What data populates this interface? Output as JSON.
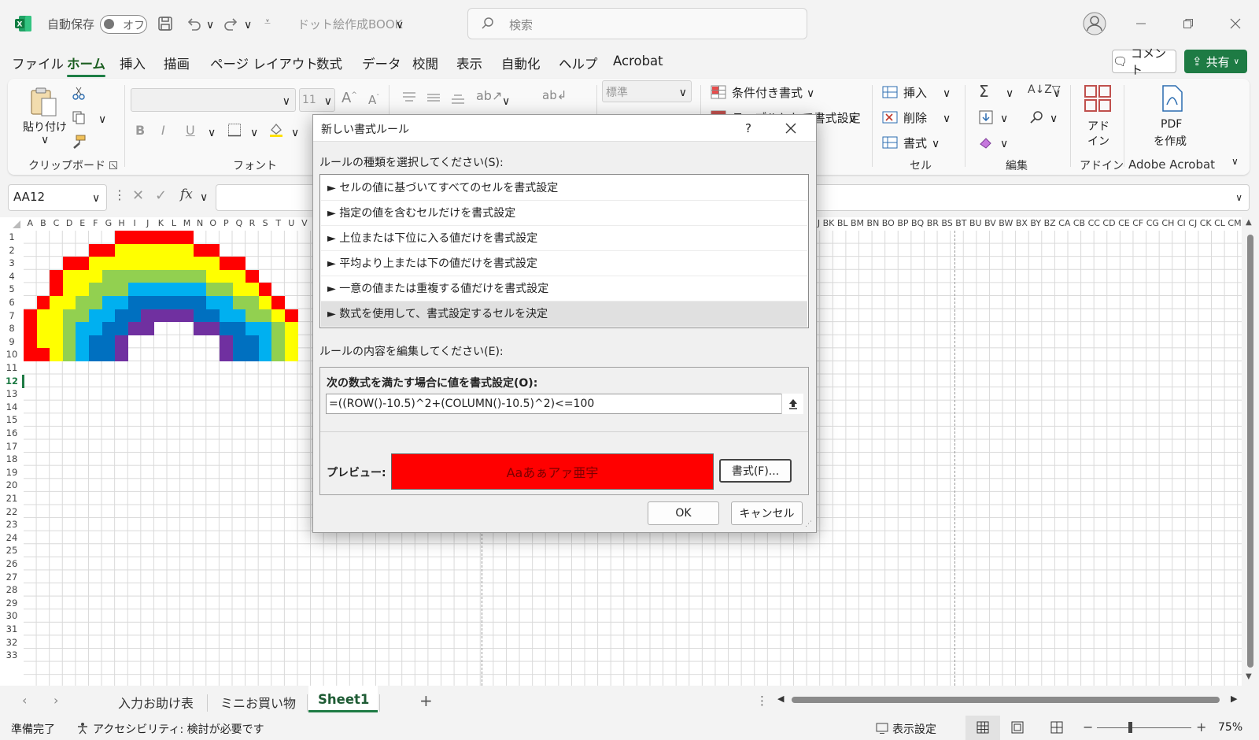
{
  "titlebar": {
    "autosave_label": "自動保存",
    "autosave_state": "オフ",
    "filename": "ドット絵作成BOOK",
    "search_placeholder": "検索"
  },
  "menu_tabs": [
    "ファイル",
    "ホーム",
    "挿入",
    "描画",
    "ページ レイアウト",
    "数式",
    "データ",
    "校閲",
    "表示",
    "自動化",
    "ヘルプ",
    "Acrobat"
  ],
  "menu_active": "ホーム",
  "actions": {
    "comment": "コメント",
    "share": "共有"
  },
  "ribbon": {
    "clipboard": {
      "paste": "貼り付け",
      "group": "クリップボード"
    },
    "font": {
      "font_size": "11",
      "group": "フォント"
    },
    "number": {
      "format": "標準"
    },
    "styles": {
      "conditional": "条件付き書式",
      "table": "テーブルとして書式設定"
    },
    "cells": {
      "insert": "挿入",
      "delete": "削除",
      "format": "書式",
      "group": "セル"
    },
    "editing": {
      "group": "編集"
    },
    "addins": {
      "label1": "アド",
      "label2": "イン",
      "group": "アドイン"
    },
    "acrobat": {
      "label1": "PDF",
      "label2": "を作成",
      "group": "Adobe Acrobat"
    }
  },
  "formula_bar": {
    "name_box": "AA12",
    "fx": "fx"
  },
  "grid": {
    "columns_left": [
      "A",
      "B",
      "C",
      "D",
      "E",
      "F",
      "G",
      "H",
      "I",
      "J",
      "K",
      "L",
      "M",
      "N",
      "O",
      "P",
      "Q",
      "R",
      "S",
      "T",
      "U",
      "V"
    ],
    "columns_right": "BI BJ BK BL BM BN BO BP BQ BR BS BT BU BV BW BX BY BZ CA CB CC CD CE CF CG CH CI CJ CK CL CM CN C",
    "rows": [
      "1",
      "2",
      "3",
      "4",
      "5",
      "6",
      "7",
      "8",
      "9",
      "10",
      "11",
      "12",
      "13",
      "14",
      "15",
      "16",
      "17",
      "18",
      "19",
      "20",
      "21",
      "22",
      "23",
      "24",
      "25",
      "26",
      "27",
      "28",
      "29",
      "30",
      "31",
      "32",
      "33"
    ],
    "selected_row": "12",
    "pixel_art": {
      "palette": {
        "R": "#ff0000",
        "O": "#ffc000",
        "Y": "#ffff00",
        "G": "#92d050",
        "C": "#00b0f0",
        "B": "#0070c0",
        "P": "#7030a0"
      },
      "rows": [
        ".......RRRRRR........",
        ".....RRYYYYYYRR......",
        "...RRYYYYYYYYYYRR....",
        "..RYYYGGGGGGGGYYYR...",
        "..RYYGGGCCCCCCGGYYR..",
        ".RYYGGCCBBBBBBCCGGYR.",
        "RYYGGCCBBPPPPBBCCGGYR",
        "RYYGCCBBPP...PPBBCCGY",
        "RYYGCBBP.......PBBCGY",
        "RRYGCBBP.......PBBCGY"
      ]
    }
  },
  "sheet_tabs": [
    "入力お助け表",
    "ミニお買い物",
    "Sheet1"
  ],
  "active_sheet": "Sheet1",
  "status": {
    "ready": "準備完了",
    "accessibility": "アクセシビリティ: 検討が必要です",
    "display_settings": "表示設定",
    "zoom": "75%"
  },
  "dialog": {
    "title": "新しい書式ルール",
    "help": "?",
    "rule_type_label": "ルールの種類を選択してください(S):",
    "rule_types": [
      "セルの値に基づいてすべてのセルを書式設定",
      "指定の値を含むセルだけを書式設定",
      "上位または下位に入る値だけを書式設定",
      "平均より上または下の値だけを書式設定",
      "一意の値または重複する値だけを書式設定",
      "数式を使用して、書式設定するセルを決定"
    ],
    "selected_rule_index": 5,
    "edit_label": "ルールの内容を編集してください(E):",
    "formula_label": "次の数式を満たす場合に値を書式設定(O):",
    "formula": "=((ROW()-10.5)^2+(COLUMN()-10.5)^2)<=100",
    "preview_label": "プレビュー:",
    "preview_text": "Aaあぁアァ亜宇",
    "preview_fill": "#ff0000",
    "format_button": "書式(F)...",
    "ok": "OK",
    "cancel": "キャンセル"
  }
}
